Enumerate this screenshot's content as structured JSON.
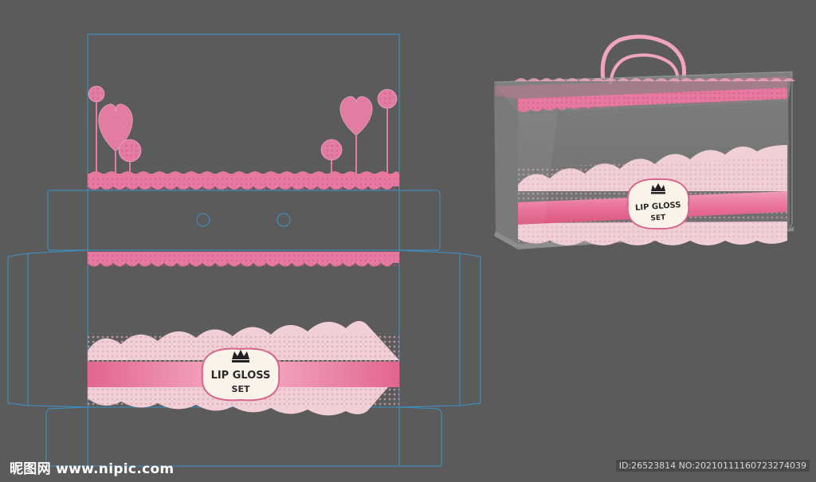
{
  "label": {
    "line1": "LIP GLOSS",
    "line2": "SET"
  },
  "watermark": {
    "brand": "昵图网",
    "url": "www.nipic.com",
    "id_text": "ID:26523814 NO:20210111160723274039"
  },
  "colors": {
    "background": "#5b5b5b",
    "dieline": "#3a93c9",
    "lace_pink": "#e87fa5",
    "ribbon_pink": "#ea6f98",
    "lace_light": "#f4d6dd",
    "label_bg": "#faf3ea",
    "handle_pink": "#f2a7c2"
  },
  "icons": {
    "crown": "crown-icon",
    "hole": "punch-hole-icon"
  }
}
